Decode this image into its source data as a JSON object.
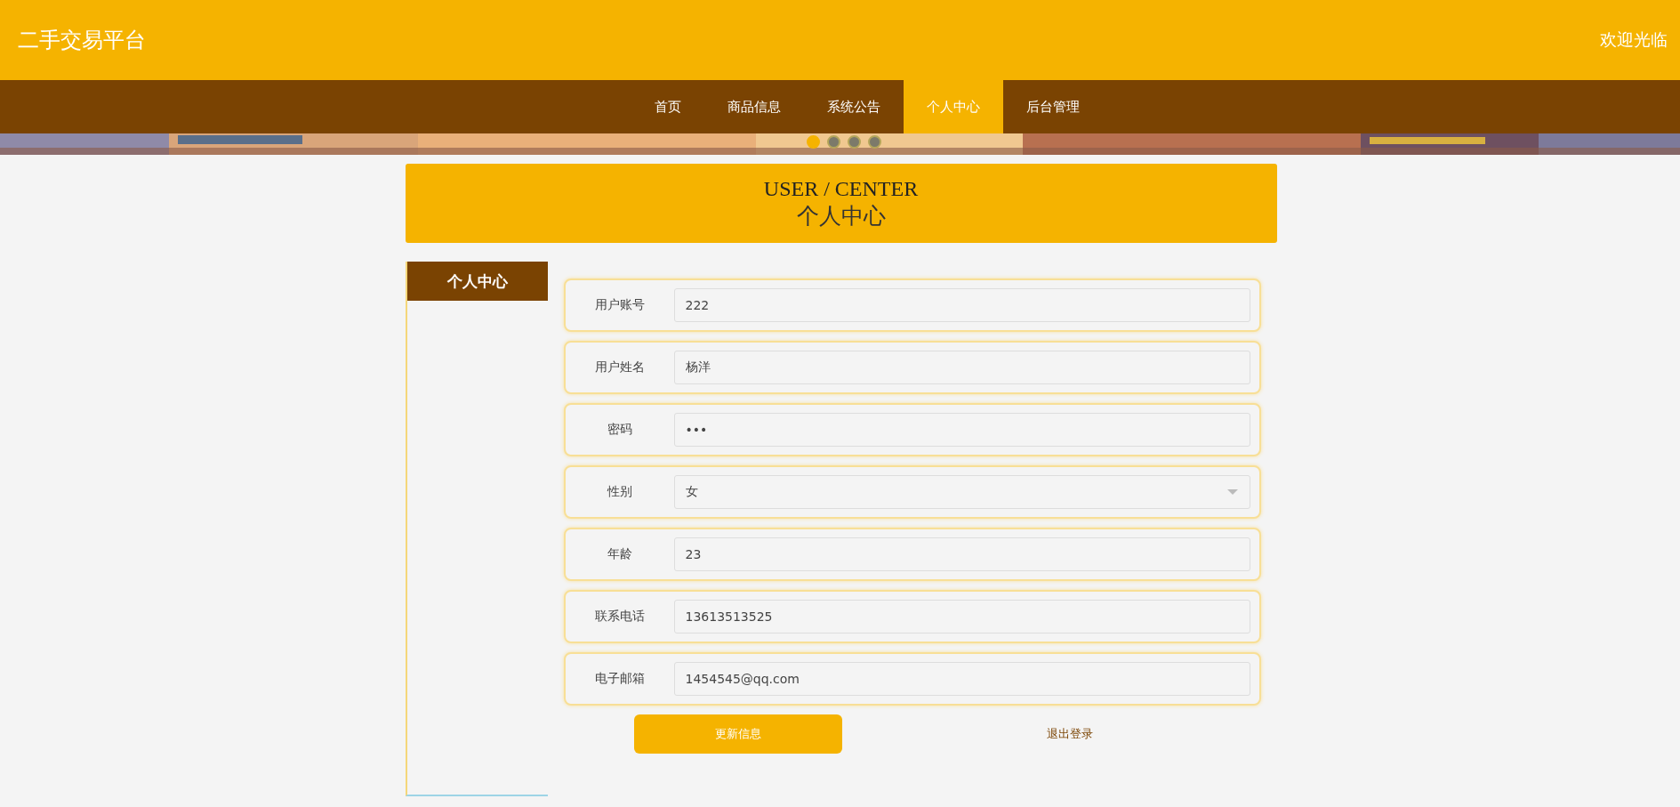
{
  "header": {
    "title": "二手交易平台",
    "welcome": "欢迎光临"
  },
  "nav": [
    {
      "label": "首页",
      "selected": false
    },
    {
      "label": "商品信息",
      "selected": false
    },
    {
      "label": "系统公告",
      "selected": false
    },
    {
      "label": "个人中心",
      "selected": true
    },
    {
      "label": "后台管理",
      "selected": false
    }
  ],
  "carousel": {
    "dots": [
      {
        "selected": true
      },
      {
        "selected": false
      },
      {
        "selected": false
      },
      {
        "selected": false
      }
    ]
  },
  "page_title": {
    "english": "USER / CENTER",
    "chinese": "个人中心"
  },
  "sidebar": {
    "items": [
      {
        "label": "个人中心",
        "selected": true
      }
    ]
  },
  "form": {
    "fields": [
      {
        "label": "用户账号",
        "value": "222",
        "kind": "text"
      },
      {
        "label": "用户姓名",
        "value": "杨洋",
        "kind": "text"
      },
      {
        "label": "密码",
        "value": "•••",
        "kind": "text"
      },
      {
        "label": "性别",
        "value": "女",
        "kind": "select"
      },
      {
        "label": "年龄",
        "value": "23",
        "kind": "text"
      },
      {
        "label": "联系电话",
        "value": "13613513525",
        "kind": "text"
      },
      {
        "label": "电子邮箱",
        "value": "1454545@qq.com",
        "kind": "text"
      }
    ],
    "buttons": {
      "update": "更新信息",
      "logout": "退出登录"
    }
  }
}
